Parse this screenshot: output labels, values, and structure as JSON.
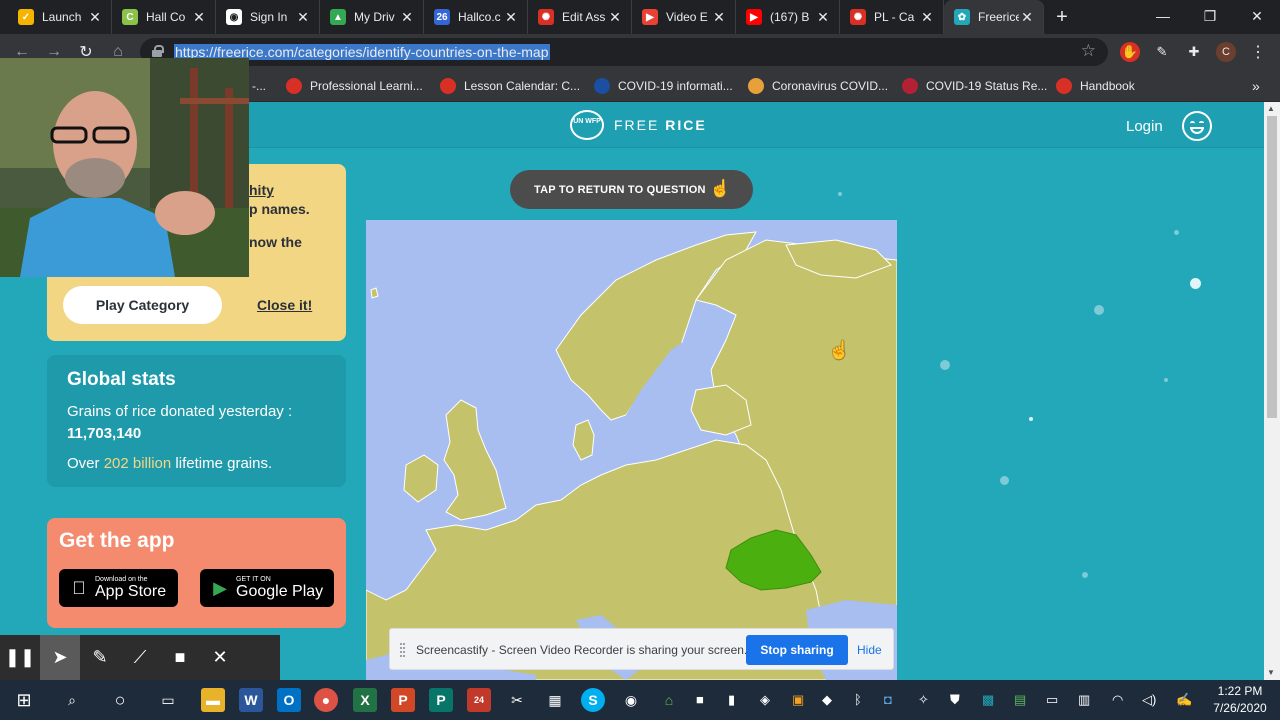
{
  "browser": {
    "tabs": [
      {
        "title": "Launch",
        "color": "#f4b400",
        "glyph": "✓"
      },
      {
        "title": "Hall Co",
        "color": "#8bc34a",
        "glyph": "C"
      },
      {
        "title": "Sign In",
        "color": "#ffffff",
        "glyph": "◉"
      },
      {
        "title": "My Driv",
        "color": "#34a853",
        "glyph": "▲"
      },
      {
        "title": "Hallco.c",
        "color": "#3367d6",
        "glyph": "26"
      },
      {
        "title": "Edit Ass",
        "color": "#d93025",
        "glyph": "✺"
      },
      {
        "title": "Video E",
        "color": "#e94235",
        "glyph": "▶"
      },
      {
        "title": "(167) B",
        "color": "#ff0000",
        "glyph": "▶"
      },
      {
        "title": "PL - Ca",
        "color": "#d93025",
        "glyph": "✺"
      },
      {
        "title": "Freerice",
        "color": "#23a8b9",
        "glyph": "✿"
      }
    ],
    "new_tab": "+",
    "url": "https://freerice.com/categories/identify-countries-on-the-map",
    "profile_initial": "C",
    "bookmarks": [
      {
        "label": "-...",
        "color": "#d93025"
      },
      {
        "label": "Professional Learni...",
        "color": "#d93025"
      },
      {
        "label": "Lesson Calendar: C...",
        "color": "#d93025"
      },
      {
        "label": "COVID-19 informati...",
        "color": "#1a4fa3"
      },
      {
        "label": "Coronavirus COVID...",
        "color": "#e8a13a"
      },
      {
        "label": "COVID-19 Status Re...",
        "color": "#b22234"
      },
      {
        "label": "Handbook",
        "color": "#d93025"
      }
    ],
    "bookmarks_more": "»"
  },
  "site": {
    "logo_seal": "UN WFP",
    "logo_free": "FREE",
    "logo_rice": "RICE",
    "login": "Login",
    "category": {
      "line1": "hity",
      "line2": "p names.",
      "line3": "now the",
      "play_label": "Play Category",
      "close_label": "Close it!"
    },
    "stats": {
      "title": "Global stats",
      "line1": "Grains of rice donated yesterday :",
      "value": "11,703,140",
      "over": "Over",
      "billion": "202 billion",
      "lifetime": "lifetime grains."
    },
    "app": {
      "title": "Get the app",
      "appstore_small": "Download on the",
      "appstore_big": "App Store",
      "google_small": "GET IT ON",
      "google_big": "Google Play"
    },
    "tap_button": "TAP TO RETURN TO QUESTION",
    "map": {
      "land_color": "#c5c26c",
      "water_color": "#a8bdf0",
      "highlight_color": "#4caf10",
      "highlight_icon": "romania-shape"
    }
  },
  "share_banner": {
    "text": "Screencastify - Screen Video Recorder is sharing your screen.",
    "stop_label": "Stop sharing",
    "hide_label": "Hide"
  },
  "taskbar": {
    "time": "1:22 PM",
    "date": "7/26/2020"
  }
}
